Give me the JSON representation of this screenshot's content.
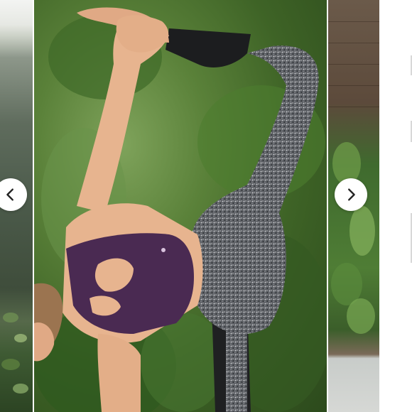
{
  "carousel": {
    "slides": [
      {
        "name": "previous-slide-image"
      },
      {
        "name": "main-slide-image"
      },
      {
        "name": "next-slide-image"
      }
    ],
    "prev_button": {
      "icon": "chevron-left-icon"
    },
    "next_button": {
      "icon": "chevron-right-icon"
    }
  },
  "colors": {
    "button_bg": "#ffffff",
    "icon": "#222222",
    "bra": "#4a2a52",
    "leggings": "#5e6166",
    "skin": "#e7b48f",
    "foliage": "#4f7b32"
  }
}
